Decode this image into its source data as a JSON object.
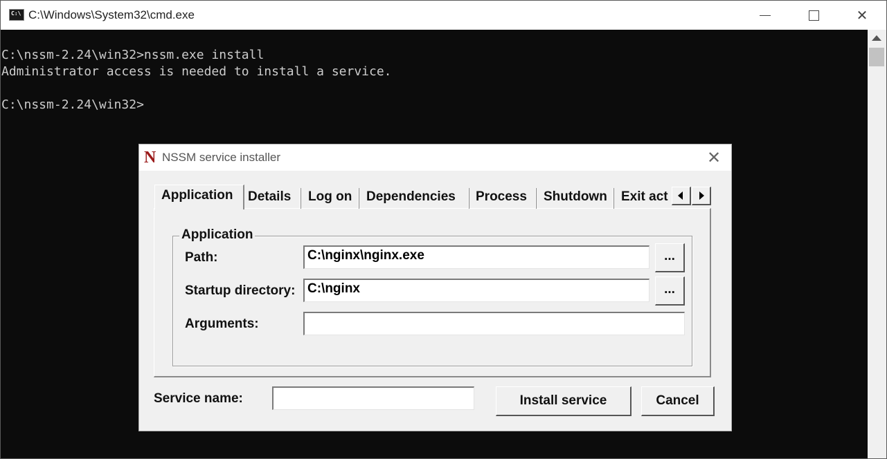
{
  "window": {
    "title": "C:\\Windows\\System32\\cmd.exe",
    "icon_text": "C:\\",
    "controls": {
      "minimize": "minimize-icon",
      "maximize": "maximize-icon",
      "close": "✕"
    }
  },
  "console": {
    "lines": [
      "C:\\nssm-2.24\\win32>nssm.exe install",
      "Administrator access is needed to install a service.",
      "",
      "C:\\nssm-2.24\\win32>"
    ]
  },
  "dialog": {
    "logo": "N",
    "title": "NSSM service installer",
    "close": "✕",
    "tabs": [
      "Application",
      "Details",
      "Log on",
      "Dependencies",
      "Process",
      "Shutdown",
      "Exit act"
    ],
    "active_tab": "Application",
    "group_title": "Application",
    "fields": {
      "path_label": "Path:",
      "path_value": "C:\\nginx\\nginx.exe",
      "startup_label": "Startup directory:",
      "startup_value": "C:\\nginx",
      "arguments_label": "Arguments:",
      "arguments_value": ""
    },
    "browse_label": "...",
    "service_name_label": "Service name:",
    "service_name_value": "",
    "install_button": "Install service",
    "cancel_button": "Cancel"
  },
  "colors": {
    "console_bg": "#0c0c0c",
    "console_text": "#cccccc",
    "dialog_bg": "#f0f0f0",
    "logo": "#9b1b1b"
  }
}
